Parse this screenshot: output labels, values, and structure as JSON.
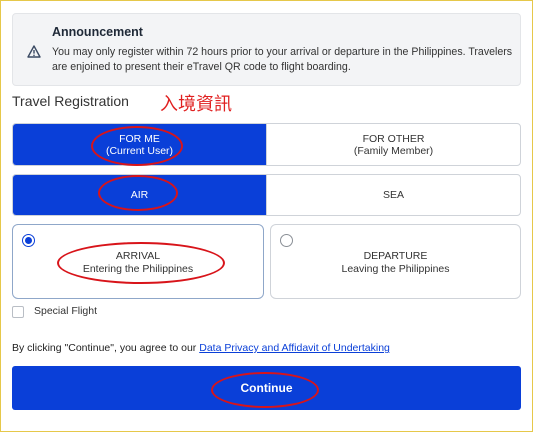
{
  "announcement": {
    "icon": "warning-triangle-icon",
    "title": "Announcement",
    "text": "You may only register within 72 hours prior to your arrival or departure in the Philippines. Travelers are enjoined to present their eTravel QR code to flight boarding."
  },
  "section": {
    "title": "Travel Registration",
    "annotation_label": "入境資訊"
  },
  "traveler_type": {
    "selected": "FOR ME",
    "options": [
      {
        "line1": "FOR ME",
        "line2": "(Current User)"
      },
      {
        "line1": "FOR OTHER",
        "line2": "(Family Member)"
      }
    ]
  },
  "travel_mode": {
    "selected": "AIR",
    "options": [
      {
        "label": "AIR"
      },
      {
        "label": "SEA"
      }
    ]
  },
  "direction": {
    "selected": "ARRIVAL",
    "options": [
      {
        "title": "ARRIVAL",
        "subtitle": "Entering the Philippines"
      },
      {
        "title": "DEPARTURE",
        "subtitle": "Leaving the Philippines"
      }
    ]
  },
  "special_flight": {
    "label": "Special Flight",
    "checked": false
  },
  "consent": {
    "text": "By clicking \"Continue\", you agree to our ",
    "link": "Data Privacy and Affidavit of Undertaking"
  },
  "continue_label": "Continue",
  "colors": {
    "accent": "#0a3fd8",
    "annotation": "#d8141a",
    "panel": "#f3f4f6"
  }
}
